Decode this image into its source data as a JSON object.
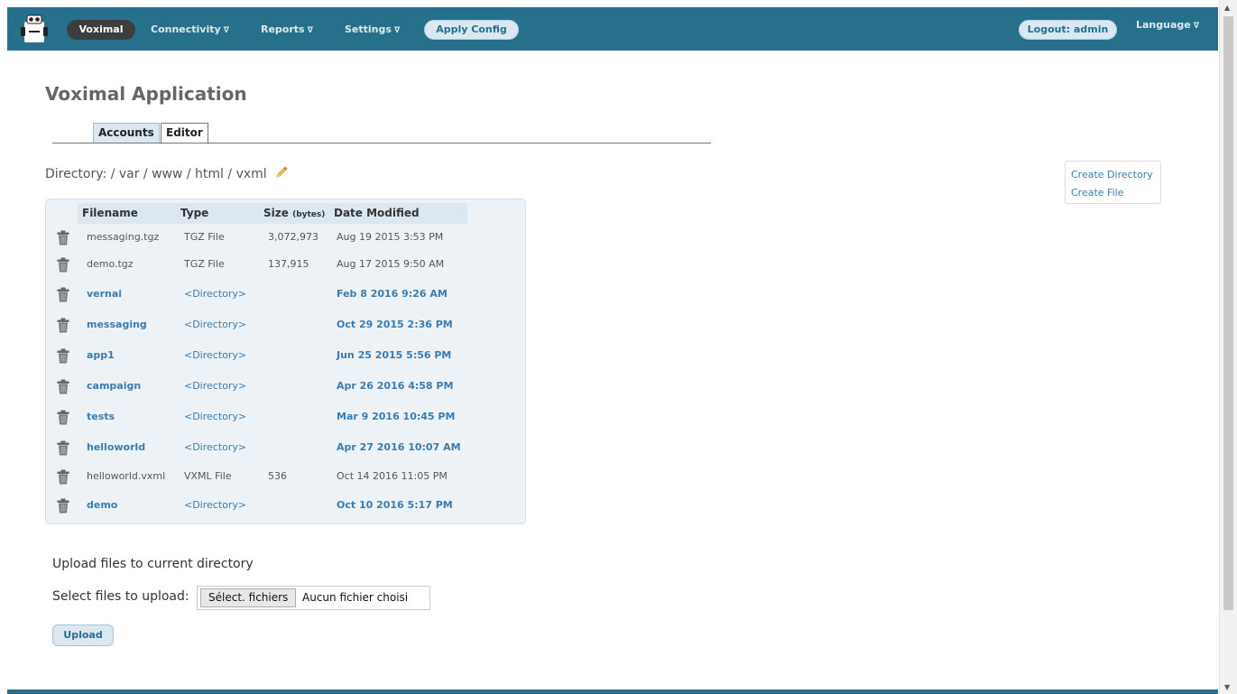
{
  "nav": {
    "brand": "Voximal",
    "connectivity": "Connectivity",
    "reports": "Reports",
    "settings": "Settings",
    "caret": "∇",
    "apply_config": "Apply Config",
    "logout": "Logout: admin",
    "language": "Language"
  },
  "page": {
    "title": "Voximal Application",
    "tabs": [
      "Accounts",
      "Editor"
    ],
    "active_tab": "Editor"
  },
  "directory": {
    "label": "Directory:",
    "path": "/ var / www / html / vxml"
  },
  "side_actions": {
    "create_directory": "Create Directory",
    "create_file": "Create File"
  },
  "table": {
    "headers": {
      "filename": "Filename",
      "type": "Type",
      "size": "Size",
      "size_unit": "(bytes)",
      "date": "Date Modified"
    },
    "rows": [
      {
        "name": "messaging.tgz",
        "type": "TGZ File",
        "size": "3,072,973",
        "date": "Aug 19 2015 3:53 PM",
        "is_dir": false
      },
      {
        "name": "demo.tgz",
        "type": "TGZ File",
        "size": "137,915",
        "date": "Aug 17 2015 9:50 AM",
        "is_dir": false
      },
      {
        "name": "vernai",
        "type": "<Directory>",
        "size": "",
        "date": "Feb 8 2016 9:26 AM",
        "is_dir": true
      },
      {
        "name": "messaging",
        "type": "<Directory>",
        "size": "",
        "date": "Oct 29 2015 2:36 PM",
        "is_dir": true
      },
      {
        "name": "app1",
        "type": "<Directory>",
        "size": "",
        "date": "Jun 25 2015 5:56 PM",
        "is_dir": true
      },
      {
        "name": "campaign",
        "type": "<Directory>",
        "size": "",
        "date": "Apr 26 2016 4:58 PM",
        "is_dir": true
      },
      {
        "name": "tests",
        "type": "<Directory>",
        "size": "",
        "date": "Mar 9 2016 10:45 PM",
        "is_dir": true
      },
      {
        "name": "helloworld",
        "type": "<Directory>",
        "size": "",
        "date": "Apr 27 2016 10:07 AM",
        "is_dir": true
      },
      {
        "name": "helloworld.vxml",
        "type": "VXML File",
        "size": "536",
        "date": "Oct 14 2016 11:05 PM",
        "is_dir": false
      },
      {
        "name": "demo",
        "type": "<Directory>",
        "size": "",
        "date": "Oct 10 2016 5:17 PM",
        "is_dir": true
      }
    ]
  },
  "upload": {
    "title": "Upload files to current directory",
    "select_label": "Select files to upload:",
    "file_button": "Sélect. fichiers",
    "no_file": "Aucun fichier choisi",
    "upload_button": "Upload"
  },
  "colors": {
    "nav_bg": "#26708c",
    "link": "#3a7cb0",
    "header_band": "#dbe8f2"
  }
}
